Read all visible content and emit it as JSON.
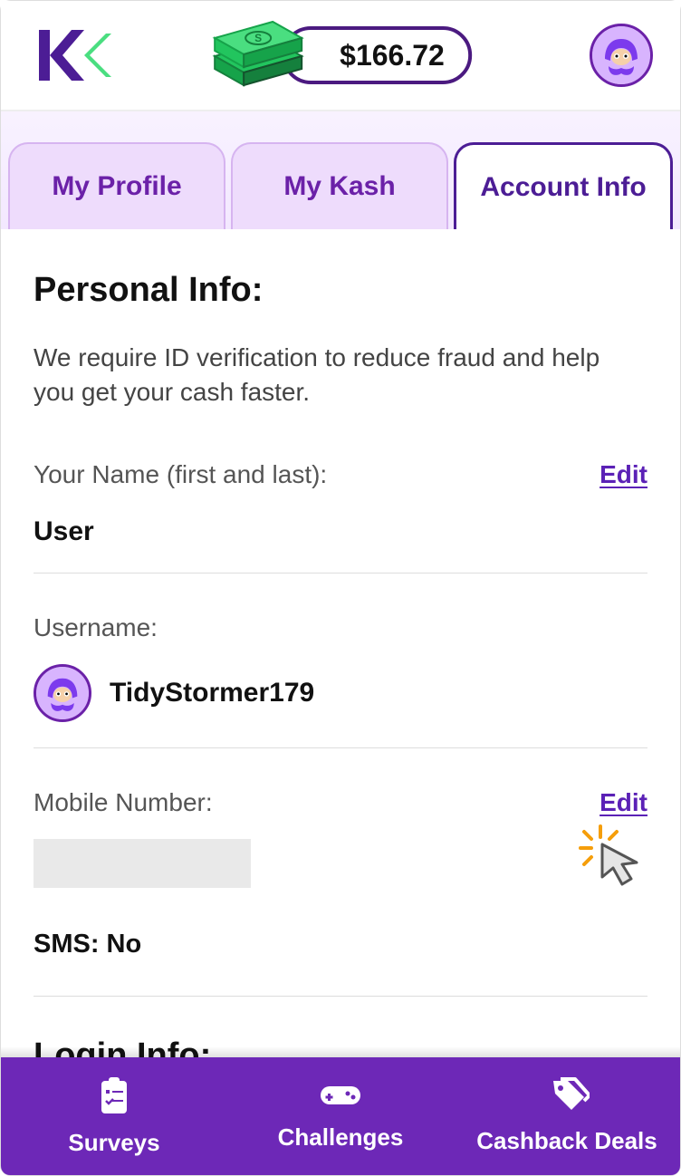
{
  "header": {
    "balance": "$166.72"
  },
  "tabs": [
    {
      "label": "My Profile"
    },
    {
      "label": "My Kash"
    },
    {
      "label": "Account Info"
    }
  ],
  "personal": {
    "title": "Personal Info:",
    "desc": "We require ID verification to reduce fraud and help you get your cash faster.",
    "name_label": "Your Name (first and last):",
    "name_value": "User",
    "name_edit": "Edit",
    "username_label": "Username:",
    "username_value": "TidyStormer179",
    "mobile_label": "Mobile Number:",
    "mobile_edit": "Edit",
    "sms_label": "SMS: No"
  },
  "login": {
    "title": "Login Info:"
  },
  "nav": [
    {
      "label": "Surveys"
    },
    {
      "label": "Challenges"
    },
    {
      "label": "Cashback Deals"
    }
  ]
}
